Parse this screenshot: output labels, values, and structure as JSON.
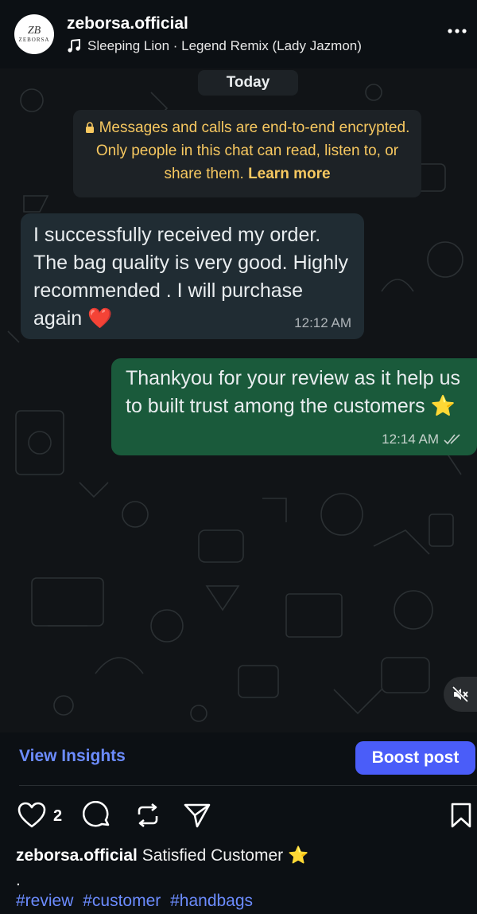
{
  "header": {
    "avatar": {
      "monogram": "ZB",
      "brand": "ZEBORSA"
    },
    "username": "zeborsa.official",
    "audio_label": "Sleeping Lion · Legend Remix (Lady Jazmon)"
  },
  "chat": {
    "date_pill": "Today",
    "encryption": {
      "text": "Messages and calls are end-to-end encrypted. Only people in this chat can read, listen to, or share them. ",
      "link": "Learn more"
    },
    "messages": [
      {
        "direction": "incoming",
        "text": "I successfully received my order. The bag quality is very good. Highly recommended . I will purchase again ❤️",
        "time": "12:12 AM"
      },
      {
        "direction": "outgoing",
        "text": "Thankyou for your review as it help us to built trust among the customers ⭐",
        "time": "12:14 AM",
        "status": "read"
      }
    ]
  },
  "post_actions": {
    "insights_label": "View Insights",
    "boost_label": "Boost post",
    "like_count": "2"
  },
  "caption": {
    "username": "zeborsa.official",
    "text": "Satisfied Customer ⭐",
    "dot": ".",
    "hashtags": [
      "#review",
      "#customer",
      "#handbags"
    ]
  },
  "colors": {
    "background": "#0c1014",
    "incoming_bubble": "#202c33",
    "outgoing_bubble": "#1a5a3b",
    "encryption_text": "#f7c860",
    "link": "#6c8cff",
    "boost_button": "#4a5df9"
  },
  "icons": [
    "music-note-icon",
    "more-icon",
    "lock-icon",
    "read-receipt-icon",
    "mute-icon",
    "heart-icon",
    "comment-icon",
    "repost-icon",
    "share-icon",
    "bookmark-icon"
  ]
}
